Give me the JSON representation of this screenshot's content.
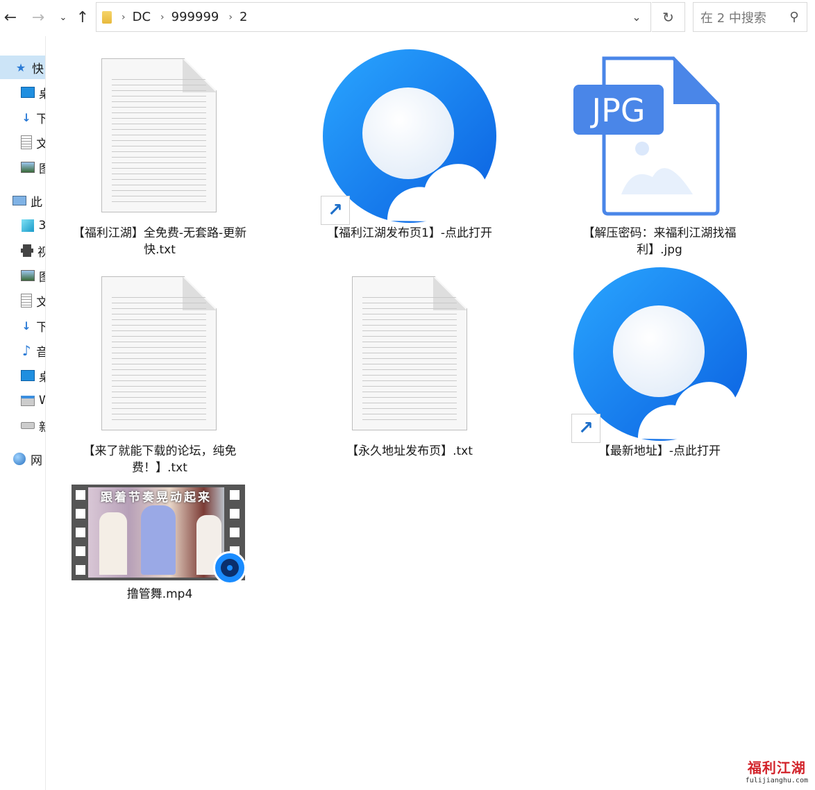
{
  "toolbar": {
    "back_icon": "arrow-left",
    "forward_icon": "arrow-right",
    "recent_icon": "chevron-down",
    "up_icon": "arrow-up",
    "breadcrumb": [
      "DC",
      "999999",
      "2"
    ],
    "refresh_icon": "refresh",
    "search_placeholder": "在 2 中搜索"
  },
  "sidebar": {
    "items": [
      {
        "label": "快",
        "icon": "star-icon",
        "active": true
      },
      {
        "label": "桌",
        "icon": "desktop-icon"
      },
      {
        "label": "下",
        "icon": "download-icon"
      },
      {
        "label": "文",
        "icon": "document-icon"
      },
      {
        "label": "图",
        "icon": "picture-icon"
      },
      {
        "label": "此",
        "icon": "pc-icon"
      },
      {
        "label": "3",
        "icon": "3d-objects-icon"
      },
      {
        "label": "视",
        "icon": "video-icon"
      },
      {
        "label": "图",
        "icon": "picture-icon"
      },
      {
        "label": "文",
        "icon": "document-icon"
      },
      {
        "label": "下",
        "icon": "download-icon"
      },
      {
        "label": "音",
        "icon": "music-icon"
      },
      {
        "label": "桌",
        "icon": "desktop-icon"
      },
      {
        "label": "W",
        "icon": "windows-drive-icon"
      },
      {
        "label": "新",
        "icon": "drive-icon"
      },
      {
        "label": "网",
        "icon": "network-icon"
      }
    ]
  },
  "files": [
    {
      "name": "【福利江湖】全免费-无套路-更新快.txt",
      "type": "txt"
    },
    {
      "name": "【福利江湖发布页1】-点此打开",
      "type": "shortcut"
    },
    {
      "name": "【解压密码：来福利江湖找福利】.jpg",
      "type": "jpg",
      "badge": "JPG"
    },
    {
      "name": "【来了就能下载的论坛，纯免费！】.txt",
      "type": "txt"
    },
    {
      "name": "【永久地址发布页】.txt",
      "type": "txt"
    },
    {
      "name": "【最新地址】-点此打开",
      "type": "shortcut"
    },
    {
      "name": "撸管舞.mp4",
      "type": "video",
      "thumb_caption": "跟着节奏晃动起来"
    }
  ],
  "watermark": {
    "title": "福利江湖",
    "url": "fulijianghu.com"
  },
  "colors": {
    "accent": "#1e6fc9",
    "jpg": "#4a86e8",
    "sidebar_active": "#cce4f7"
  }
}
